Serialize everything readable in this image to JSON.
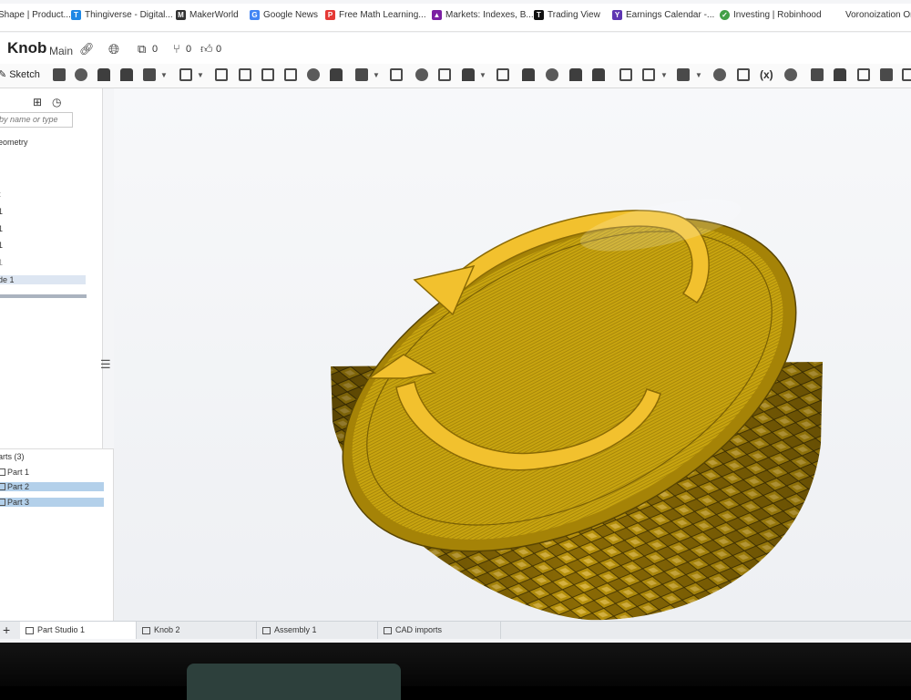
{
  "bookmarks": [
    {
      "label": "Shape | Product...",
      "color": "#888888"
    },
    {
      "label": "Thingiverse - Digital...",
      "color": "#1e88e5"
    },
    {
      "label": "MakerWorld",
      "color": "#333333"
    },
    {
      "label": "Google News",
      "color": "#4285f4"
    },
    {
      "label": "Free Math Learning...",
      "color": "#e53935"
    },
    {
      "label": "Markets: Indexes, B...",
      "color": "#7b1fa2"
    },
    {
      "label": "Trading View",
      "color": "#111111"
    },
    {
      "label": "Earnings Calendar -...",
      "color": "#5e35b1"
    },
    {
      "label": "Investing | Robinhood",
      "color": "#43a047"
    },
    {
      "label": "Voronoization On",
      "color": "#ffffff"
    }
  ],
  "document": {
    "title": "Knob",
    "branch": "Main",
    "link_icon": "link-icon",
    "globe_icon": "globe-icon",
    "copies_count": "0",
    "branches_count": "0",
    "likes_count": "0"
  },
  "toolbar": {
    "sketch_label": "Sketch",
    "variables_label": "(x)"
  },
  "feature_panel": {
    "filter_placeholder": "by name or type",
    "items": [
      {
        "label": "eometry",
        "selected": false
      },
      {
        "label": "",
        "selected": false
      },
      {
        "label": "t",
        "selected": false
      },
      {
        "label": "1",
        "selected": false
      },
      {
        "label": "1",
        "selected": false
      },
      {
        "label": "1",
        "selected": false
      },
      {
        "label": "1",
        "selected": false
      },
      {
        "label": "de 1",
        "selected": true
      }
    ]
  },
  "parts_panel": {
    "header": "arts (3)",
    "parts": [
      {
        "label": "Part 1",
        "selected": false
      },
      {
        "label": "Part 2",
        "selected": true
      },
      {
        "label": "Part 3",
        "selected": true
      }
    ]
  },
  "tabs": [
    {
      "label": "Part Studio 1",
      "active": true
    },
    {
      "label": "Knob 2",
      "active": false
    },
    {
      "label": "Assembly 1",
      "active": false
    },
    {
      "label": "CAD imports",
      "active": false
    }
  ],
  "colors": {
    "knob_top": "#c9a50f",
    "knob_side": "#9c7b06",
    "arrow": "#f2c12e"
  }
}
